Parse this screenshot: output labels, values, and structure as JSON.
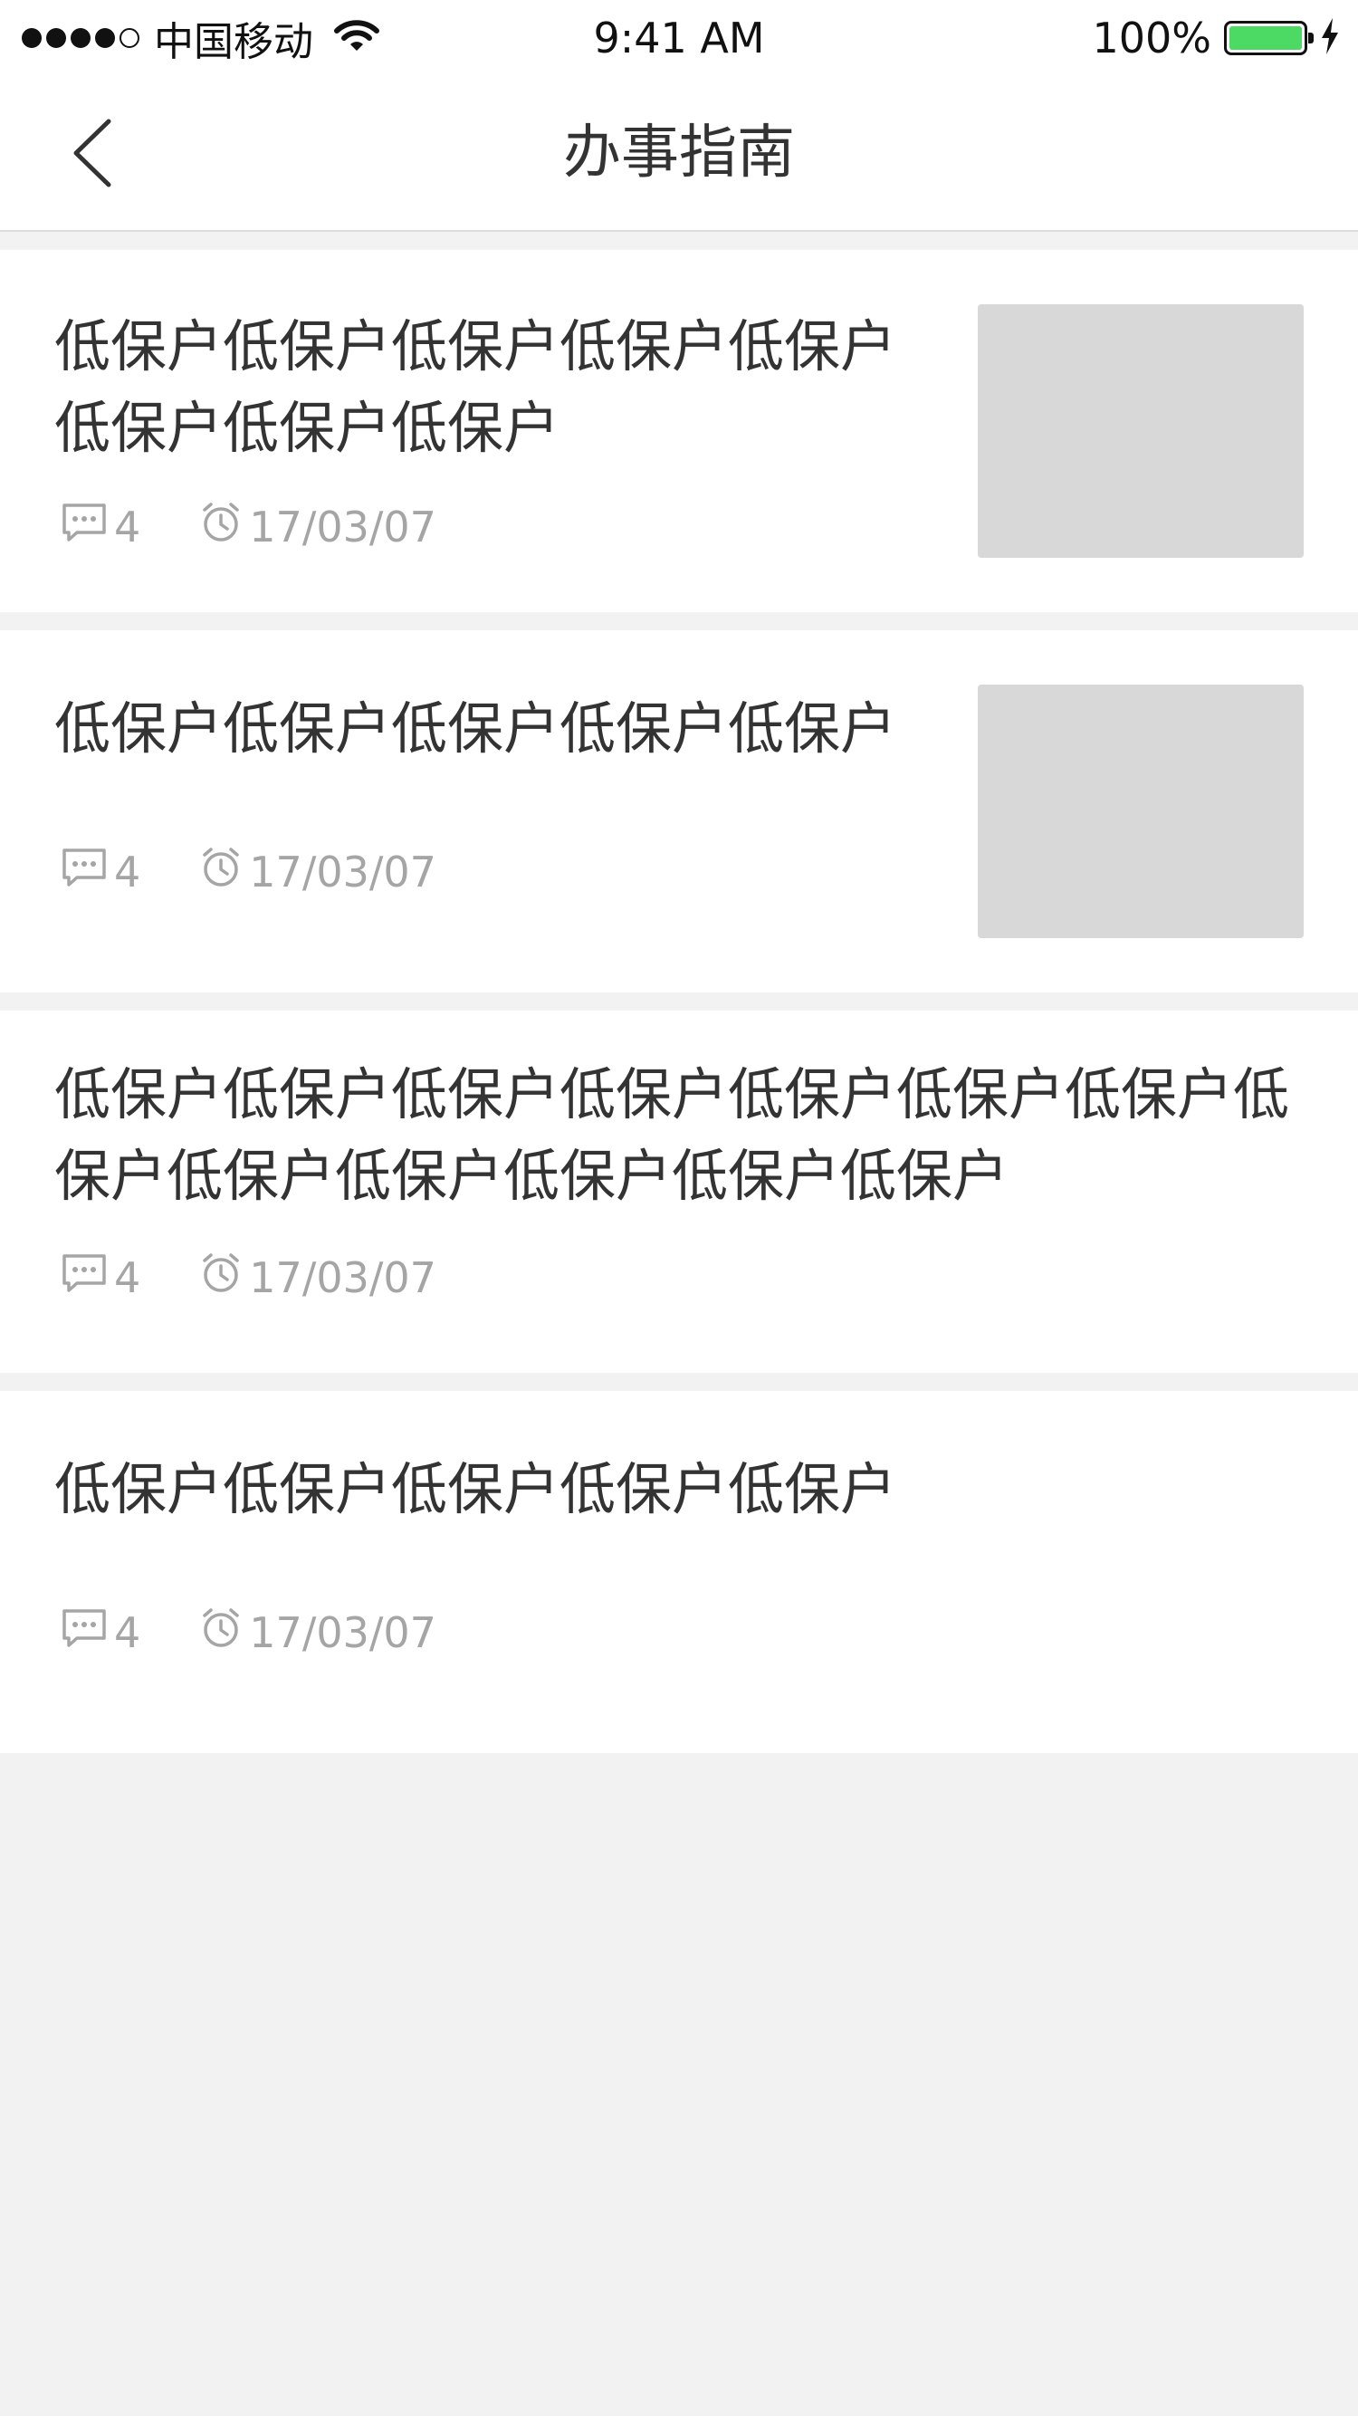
{
  "status_bar": {
    "carrier": "中国移动",
    "time": "9:41 AM",
    "battery": "100%",
    "battery_color": "#4cd964"
  },
  "nav": {
    "title": "办事指南",
    "back_icon": "chevron-left-icon"
  },
  "items": [
    {
      "title": "低保户低保户低保户低保户低保户低保户低保户低保户",
      "comments": "4",
      "date": "17/03/07",
      "has_thumbnail": true
    },
    {
      "title": "低保户低保户低保户低保户低保户",
      "comments": "4",
      "date": "17/03/07",
      "has_thumbnail": true
    },
    {
      "title": "低保户低保户低保户低保户低保户低保户低保户低保户低保户低保户低保户低保户低保户",
      "comments": "4",
      "date": "17/03/07",
      "has_thumbnail": false
    },
    {
      "title": "低保户低保户低保户低保户低保户",
      "comments": "4",
      "date": "17/03/07",
      "has_thumbnail": false
    }
  ],
  "icons": {
    "comment": "comment-icon",
    "clock": "clock-icon"
  },
  "colors": {
    "background": "#f2f2f2",
    "card": "#ffffff",
    "meta_text": "#a5a5a5",
    "thumbnail": "#d8d8d8"
  }
}
